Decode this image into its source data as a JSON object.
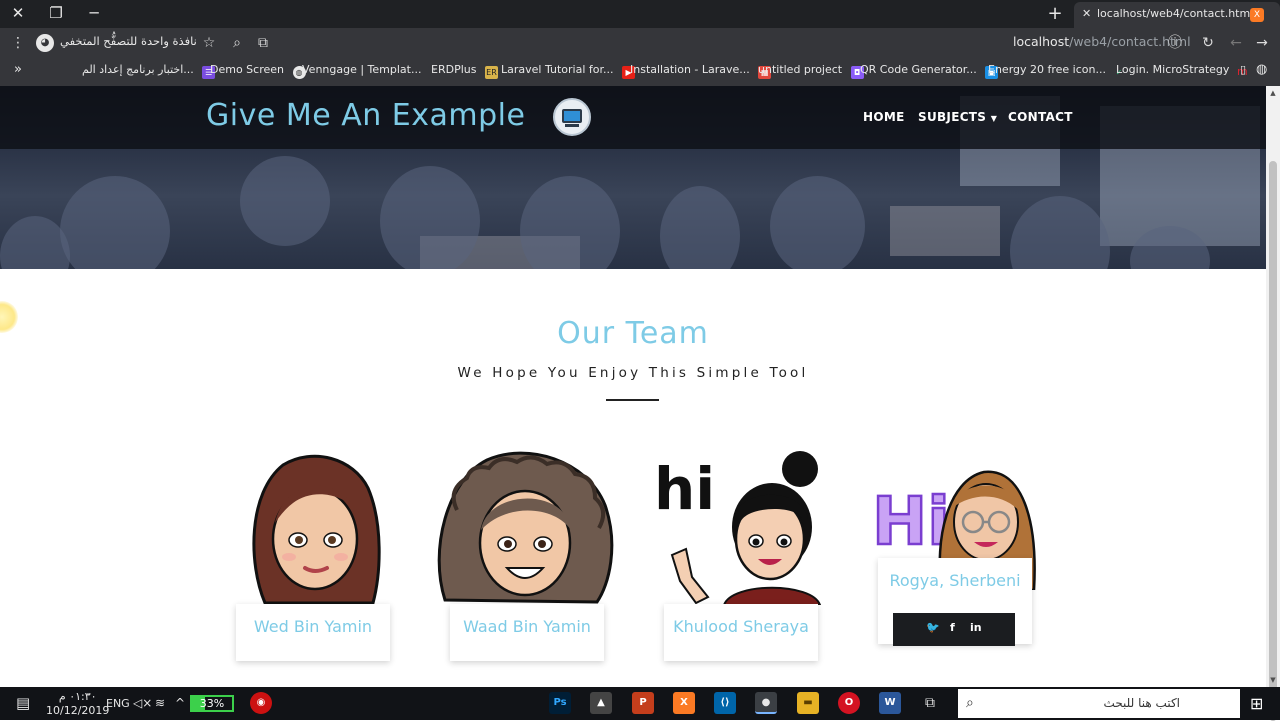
{
  "browser": {
    "tab_title": "localhost/web4/contact.html",
    "new_tab_icon": "+",
    "url_host": "localhost",
    "url_path": "/web4/contact.html",
    "incognito_label": "نافذة واحدة للتصفُّح المتخفي",
    "bookmarks": [
      {
        "label": "اختبار برنامج إعداد الم...",
        "color": "#7a4de0"
      },
      {
        "label": "Demo Screen",
        "color": "#6b6b6b"
      },
      {
        "label": "Venngage | Templat...",
        "color": "#444"
      },
      {
        "label": "ERDPlus",
        "color": "#c79a26"
      },
      {
        "label": "Laravel Tutorial for...",
        "color": "#e62117"
      },
      {
        "label": "Installation - Larave...",
        "color": "#e0473d"
      },
      {
        "label": "untitled project",
        "color": "#8a5cf6"
      },
      {
        "label": "QR Code Generator...",
        "color": "#1a8fe3"
      },
      {
        "label": "Energy 20 free icon...",
        "color": "#34b97a"
      },
      {
        "label": "Login. MicroStrategy",
        "color": "#d9232e"
      }
    ]
  },
  "site": {
    "brand": "Give Me An Example",
    "nav": {
      "home": "HOME",
      "subjects": "SUBJECTS",
      "contact": "CONTACT"
    }
  },
  "team": {
    "title": "Our Team",
    "subtitle": "We Hope You Enjoy This Simple Tool",
    "members": [
      {
        "name": "Wed Bin Yamin",
        "avatar_text": ""
      },
      {
        "name": "Waad Bin Yamin",
        "avatar_text": ""
      },
      {
        "name": "Khulood Sheraya",
        "avatar_text": "hi"
      },
      {
        "name": "Rogya, Sherbeni",
        "avatar_text": "Hi"
      }
    ],
    "social_icons": [
      "twitter-icon",
      "facebook-icon",
      "linkedin-icon"
    ]
  },
  "taskbar": {
    "time": "٠١:٣٠ م",
    "date": "10/12/2019",
    "language": "ENG",
    "battery": "33%",
    "battery_level": 0.33,
    "search_placeholder": "اكتب هنا للبحث",
    "apps": [
      {
        "name": "photoshop",
        "label": "Ps",
        "color": "#001e36"
      },
      {
        "name": "photos",
        "label": "▲",
        "color": "#444"
      },
      {
        "name": "powerpoint",
        "label": "P",
        "color": "#c43e1c"
      },
      {
        "name": "xampp",
        "label": "X",
        "color": "#fb7a24"
      },
      {
        "name": "vscode",
        "label": "⟨⟩",
        "color": "#0065a9"
      },
      {
        "name": "chrome",
        "label": "●",
        "color": "#3b3f44"
      },
      {
        "name": "file-explorer",
        "label": "▬",
        "color": "#e7b225"
      },
      {
        "name": "opera",
        "label": "O",
        "color": "#d41322"
      },
      {
        "name": "word",
        "label": "W",
        "color": "#2b579a"
      }
    ]
  }
}
